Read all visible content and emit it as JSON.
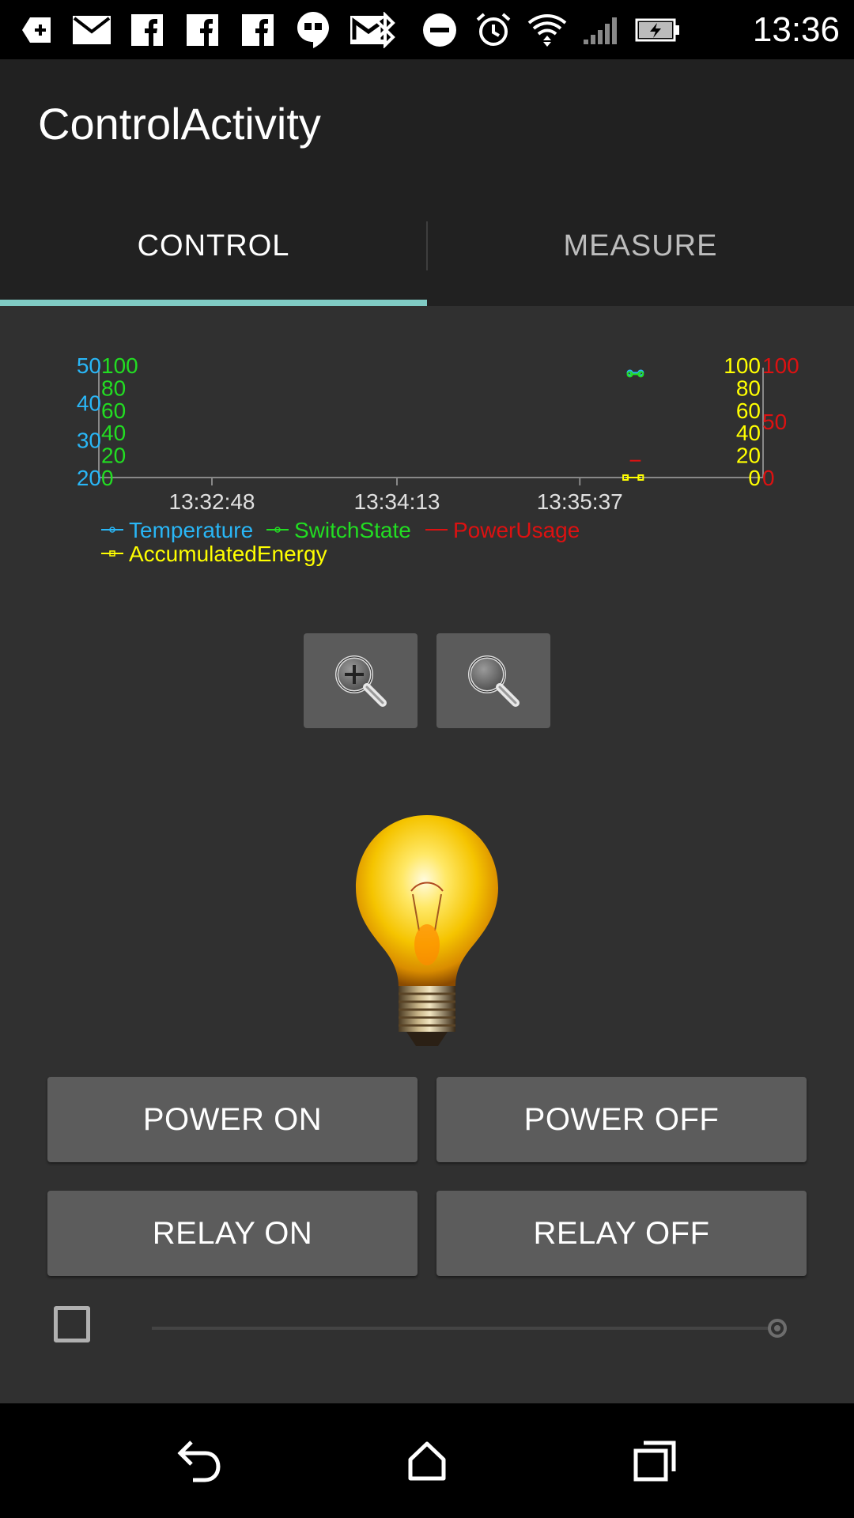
{
  "status_bar": {
    "time": "13:36",
    "left_icons": [
      "add-box-icon",
      "mail-icon",
      "facebook-icon",
      "facebook-icon",
      "facebook-icon",
      "hangouts-icon",
      "gmail-icon"
    ],
    "right_icons": [
      "bluetooth-icon",
      "do-not-disturb-icon",
      "alarm-icon",
      "wifi-icon",
      "cell-signal-icon",
      "battery-charging-icon"
    ]
  },
  "app_bar": {
    "title": "ControlActivity"
  },
  "tabs": [
    {
      "label": "CONTROL",
      "selected": true
    },
    {
      "label": "MEASURE",
      "selected": false
    }
  ],
  "chart_data": {
    "type": "line",
    "x_tick_labels": [
      "13:32:48",
      "13:34:13",
      "13:35:37"
    ],
    "axes": {
      "temperature": {
        "side": "left",
        "ticks": [
          "50",
          "40",
          "30",
          "20"
        ],
        "color": "#29b6f6"
      },
      "switch_state": {
        "side": "left",
        "ticks": [
          "100",
          "80",
          "60",
          "40",
          "20",
          "0"
        ],
        "color": "#22dd22"
      },
      "accumulated_energy": {
        "side": "right",
        "ticks": [
          "100",
          "80",
          "60",
          "40",
          "20",
          "0"
        ],
        "color": "#ffff00"
      },
      "power_usage": {
        "side": "right",
        "ticks": [
          "100",
          "50",
          "0"
        ],
        "color": "#dd1111"
      }
    },
    "series": [
      {
        "name": "Temperature",
        "color": "#29b6f6",
        "points": [
          {
            "x": "13:36:00",
            "y": 48
          },
          {
            "x": "13:36:05",
            "y": 48
          }
        ]
      },
      {
        "name": "SwitchState",
        "color": "#22dd22",
        "points": [
          {
            "x": "13:36:00",
            "y": 92
          },
          {
            "x": "13:36:05",
            "y": 92
          }
        ]
      },
      {
        "name": "PowerUsage",
        "color": "#dd1111",
        "points": [
          {
            "x": "13:36:00",
            "y": 15
          },
          {
            "x": "13:36:05",
            "y": 15
          }
        ]
      },
      {
        "name": "AccumulatedEnergy",
        "color": "#ffff00",
        "points": [
          {
            "x": "13:35:58",
            "y": 0
          },
          {
            "x": "13:36:05",
            "y": 0
          }
        ]
      }
    ],
    "legend": [
      "Temperature",
      "SwitchState",
      "PowerUsage",
      "AccumulatedEnergy"
    ],
    "legend_position": "bottom-left",
    "grid": false
  },
  "zoom": {
    "zoom_in_icon": "zoom-in-icon",
    "zoom_reset_icon": "zoom-out-icon"
  },
  "bulb": {
    "icon": "light-bulb-on-image"
  },
  "buttons": {
    "power_on": "POWER ON",
    "power_off": "POWER OFF",
    "relay_on": "RELAY ON",
    "relay_off": "RELAY OFF"
  },
  "controls": {
    "checkbox_checked": false,
    "slider_value": 1.0
  },
  "nav_bar": {
    "icons": [
      "back-icon",
      "home-icon",
      "recents-icon"
    ]
  }
}
